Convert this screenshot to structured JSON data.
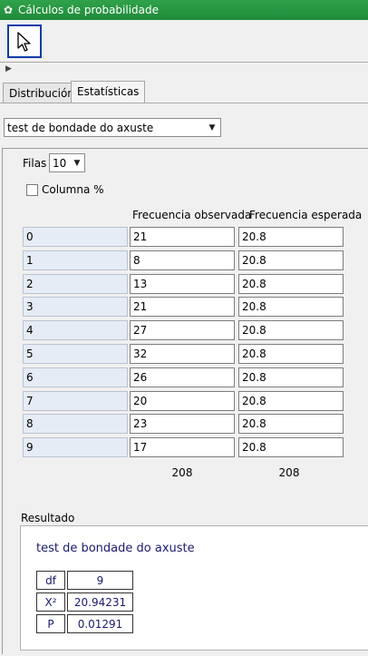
{
  "window": {
    "title": "Cálculos de probabilidade",
    "icon": "geogebra-icon"
  },
  "toolbar": {
    "tool": "pointer-tool"
  },
  "tabs": [
    {
      "label": "Distribución",
      "active": false
    },
    {
      "label": "Estatísticas",
      "active": true
    }
  ],
  "test_select": {
    "value": "test de bondade do axuste"
  },
  "rows_control": {
    "label": "Filas",
    "value": "10"
  },
  "percent_checkbox": {
    "label": "Columna %",
    "checked": false
  },
  "table": {
    "headers": {
      "observed": "Frecuencia observada",
      "expected": "Frecuencia esperada"
    },
    "rows": [
      {
        "label": "0",
        "observed": "21",
        "expected": "20.8"
      },
      {
        "label": "1",
        "observed": "8",
        "expected": "20.8"
      },
      {
        "label": "2",
        "observed": "13",
        "expected": "20.8"
      },
      {
        "label": "3",
        "observed": "21",
        "expected": "20.8"
      },
      {
        "label": "4",
        "observed": "27",
        "expected": "20.8"
      },
      {
        "label": "5",
        "observed": "32",
        "expected": "20.8"
      },
      {
        "label": "6",
        "observed": "26",
        "expected": "20.8"
      },
      {
        "label": "7",
        "observed": "20",
        "expected": "20.8"
      },
      {
        "label": "8",
        "observed": "23",
        "expected": "20.8"
      },
      {
        "label": "9",
        "observed": "17",
        "expected": "20.8"
      }
    ],
    "totals": {
      "observed": "208",
      "expected": "208"
    }
  },
  "result": {
    "section_label": "Resultado",
    "title": "test de bondade do axuste",
    "stats": [
      {
        "label": "df",
        "value": "9"
      },
      {
        "label": "X²",
        "value": "20.94231"
      },
      {
        "label": "P",
        "value": "0.01291"
      }
    ]
  },
  "colors": {
    "titlebar": "#1f8a39",
    "row_label_bg": "#e5ecf6",
    "result_text": "#1a1a6e",
    "tool_border": "#0b3aa8"
  }
}
